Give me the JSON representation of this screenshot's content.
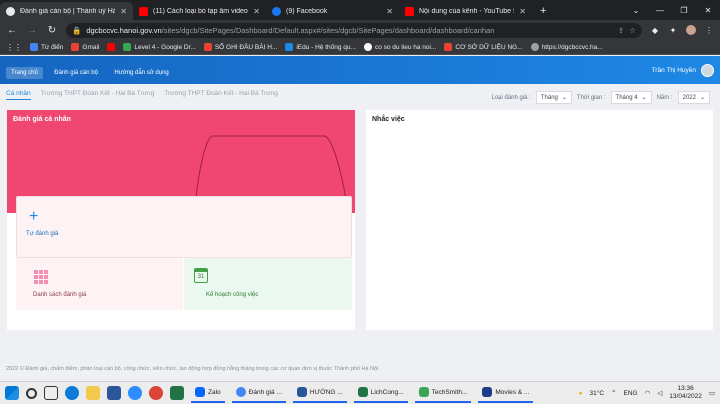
{
  "browser": {
    "tabs": [
      {
        "title": "Đánh giá cán bộ | Thành uỷ Hà N",
        "icon": "globe-icon",
        "color": "#e8eaed",
        "active": true
      },
      {
        "title": "(11) Cách loại bỏ tạp âm video b",
        "icon": "youtube-icon",
        "color": "#ff0000"
      },
      {
        "title": "(9) Facebook",
        "icon": "facebook-icon",
        "color": "#1877f2"
      },
      {
        "title": "Nội dung của kênh - YouTube St",
        "icon": "youtube-icon",
        "color": "#ff0000"
      }
    ],
    "url_host": "dgcbccvc.hanoi.gov.vn",
    "url_path": "/sites/dgcb/SitePages/Dashboard/Default.aspx#/sites/dgcb/SitePages/dashboard/dashboard/canhan",
    "bookmarks": [
      {
        "label": "Từ điển",
        "color": "#4285f4"
      },
      {
        "label": "Gmail",
        "color": "#ea4335"
      },
      {
        "label": "",
        "color": "#ff0000"
      },
      {
        "label": "Level 4 - Google Dr...",
        "color": "#34a853"
      },
      {
        "label": "SỔ GHI ĐẦU BÀI H...",
        "color": "#ea4335"
      },
      {
        "label": "iEdu - Hệ thống qu...",
        "color": "#1e88e5"
      },
      {
        "label": "co so du lieu ha noi...",
        "color": "#ffffff"
      },
      {
        "label": "CƠ SỞ DỮ LIỆU NG...",
        "color": "#ea4335"
      },
      {
        "label": "https://dgcbccvc.ha...",
        "color": "#9aa0a6"
      }
    ]
  },
  "app": {
    "nav": [
      "Trang chủ",
      "Đánh giá cán bộ",
      "Hướng dẫn sử dụng"
    ],
    "user_name": "Trần Thị Huyền",
    "subtabs": [
      "Cá nhân",
      "Trường THPT Đoàn Kết - Hai Bà Trưng",
      "Trường THPT Đoàn Kết - Hai Bà Trưng"
    ],
    "filters": {
      "type_label": "Loại đánh giá :",
      "type_value": "Tháng",
      "time_label": "Thời gian :",
      "month_value": "Tháng 4",
      "year_label": "Năm :",
      "year_value": "2022"
    },
    "left_card": {
      "title": "Đánh giá cá nhân",
      "self_eval": "Tự đánh giá",
      "list": "Danh sách đánh giá",
      "plan": "Kế hoạch công việc",
      "plan_day": "31"
    },
    "right_card": {
      "title": "Nhắc việc"
    },
    "footer": "2022 © Đánh giá, chấm điểm, phân loại cán bộ, công chức, viên chức, lao động hợp đồng hằng tháng trong các cơ quan đơn vị thuộc Thành phố Hà Nội"
  },
  "taskbar": {
    "apps": [
      {
        "label": "Zalo",
        "color": "#0068ff"
      },
      {
        "label": "Đánh giá ...",
        "color": "#4285f4"
      },
      {
        "label": "HƯỚNG ...",
        "color": "#2b579a"
      },
      {
        "label": "LichCong...",
        "color": "#217346"
      },
      {
        "label": "TechSmith...",
        "color": "#3aa655"
      },
      {
        "label": "Movies & ...",
        "color": "#1f3b8a"
      }
    ],
    "temperature": "31°C",
    "lang": "ENG",
    "time": "13:36",
    "date": "13/04/2022"
  }
}
